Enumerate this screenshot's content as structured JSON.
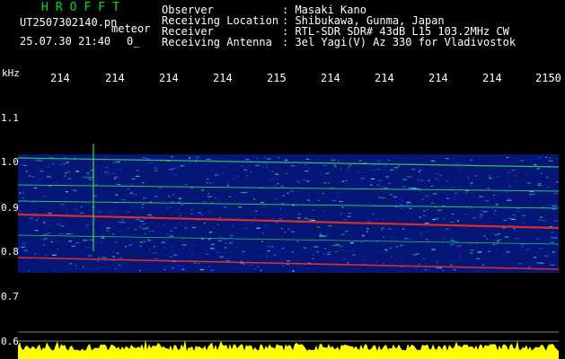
{
  "header": {
    "app_title": "HROFFT",
    "file_name": "UT2507302140.pn",
    "mode": "meteor",
    "date_time": "25.07.30 21:40",
    "counter": "0_",
    "fields": [
      {
        "label": "Observer",
        "value": ": Masaki Kano"
      },
      {
        "label": "Receiving Location",
        "value": ": Shibukawa, Gunma, Japan"
      },
      {
        "label": "Receiver",
        "value": ": RTL-SDR SDR# 43dB L15 103.2MHz CW"
      },
      {
        "label": "Receiving Antenna",
        "value": ": 3el Yagi(V) Az 330 for Vladivostok"
      }
    ]
  },
  "axes": {
    "y_unit": "kHz",
    "x_ticks": [
      "214",
      "214",
      "214",
      "214",
      "215",
      "214",
      "214",
      "214",
      "214",
      "2150"
    ],
    "y_ticks": [
      "1.1",
      "1.0",
      "0.9",
      "0.8",
      "0.7",
      "0.6"
    ]
  },
  "colors": {
    "title_green": "#00e000",
    "background": "#000000",
    "spectrum_blue": "#0a28d8",
    "signal_red": "#ff3020",
    "signal_green": "#30e060",
    "noise_yellow": "#ffff00",
    "grid_white": "#ffffff"
  }
}
